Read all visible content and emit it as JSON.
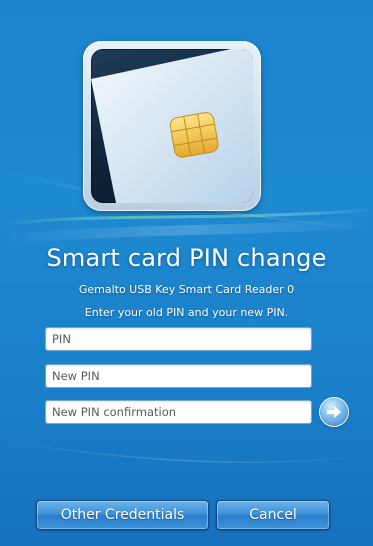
{
  "title": "Smart card PIN change",
  "reader_name": "Gemalto USB Key Smart Card Reader 0",
  "instruction": "Enter your old PIN and your new PIN.",
  "fields": {
    "pin_placeholder": "PIN",
    "new_pin_placeholder": "New PIN",
    "confirm_placeholder": "New PIN confirmation"
  },
  "buttons": {
    "other_credentials": "Other Credentials",
    "cancel": "Cancel"
  },
  "icons": {
    "tile": "smart-card-icon",
    "submit": "arrow-right-icon"
  },
  "colors": {
    "background": "#1c84cd",
    "button": "#3b8fd6",
    "text": "#ffffff"
  }
}
